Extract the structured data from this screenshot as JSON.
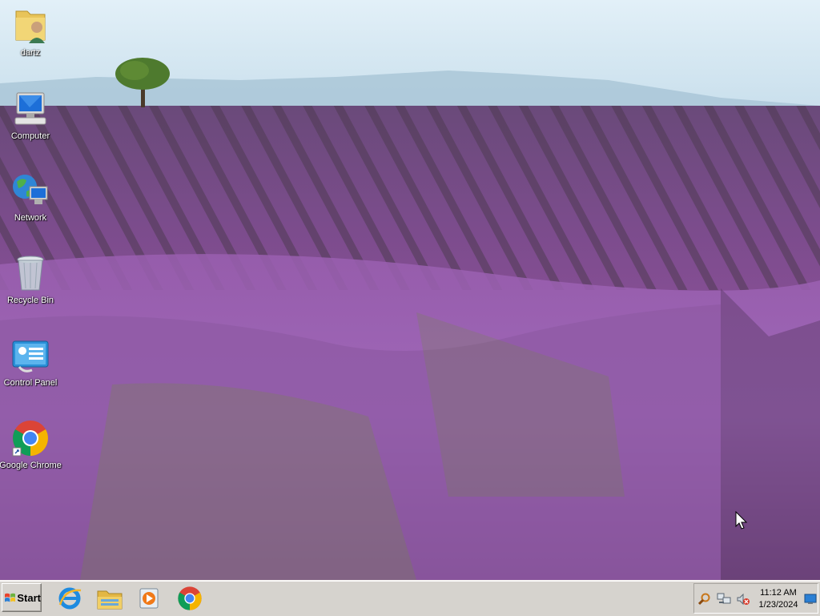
{
  "desktop": {
    "icons": [
      {
        "label": "dartz",
        "icon": "user-folder-icon"
      },
      {
        "label": "Computer",
        "icon": "computer-icon"
      },
      {
        "label": "Network",
        "icon": "network-icon"
      },
      {
        "label": "Recycle Bin",
        "icon": "recycle-bin-icon"
      },
      {
        "label": "Control Panel",
        "icon": "control-panel-icon"
      },
      {
        "label": "Google Chrome",
        "icon": "chrome-icon"
      }
    ]
  },
  "taskbar": {
    "start_label": "Start",
    "pinned": [
      {
        "name": "Internet Explorer",
        "icon": "internet-explorer-icon"
      },
      {
        "name": "File Explorer",
        "icon": "file-explorer-icon"
      },
      {
        "name": "Windows Media Player",
        "icon": "media-player-icon"
      },
      {
        "name": "Google Chrome",
        "icon": "chrome-icon"
      }
    ],
    "tray": {
      "icons": [
        "search-icon",
        "network-status-icon",
        "volume-muted-icon"
      ],
      "time": "11:12 AM",
      "date": "1/23/2024",
      "show_desktop_icon": "show-desktop-icon"
    }
  },
  "colors": {
    "taskbar_bg": "#d6d3ce",
    "sky": "#dcecf4",
    "lavender": "#8a4d96"
  }
}
